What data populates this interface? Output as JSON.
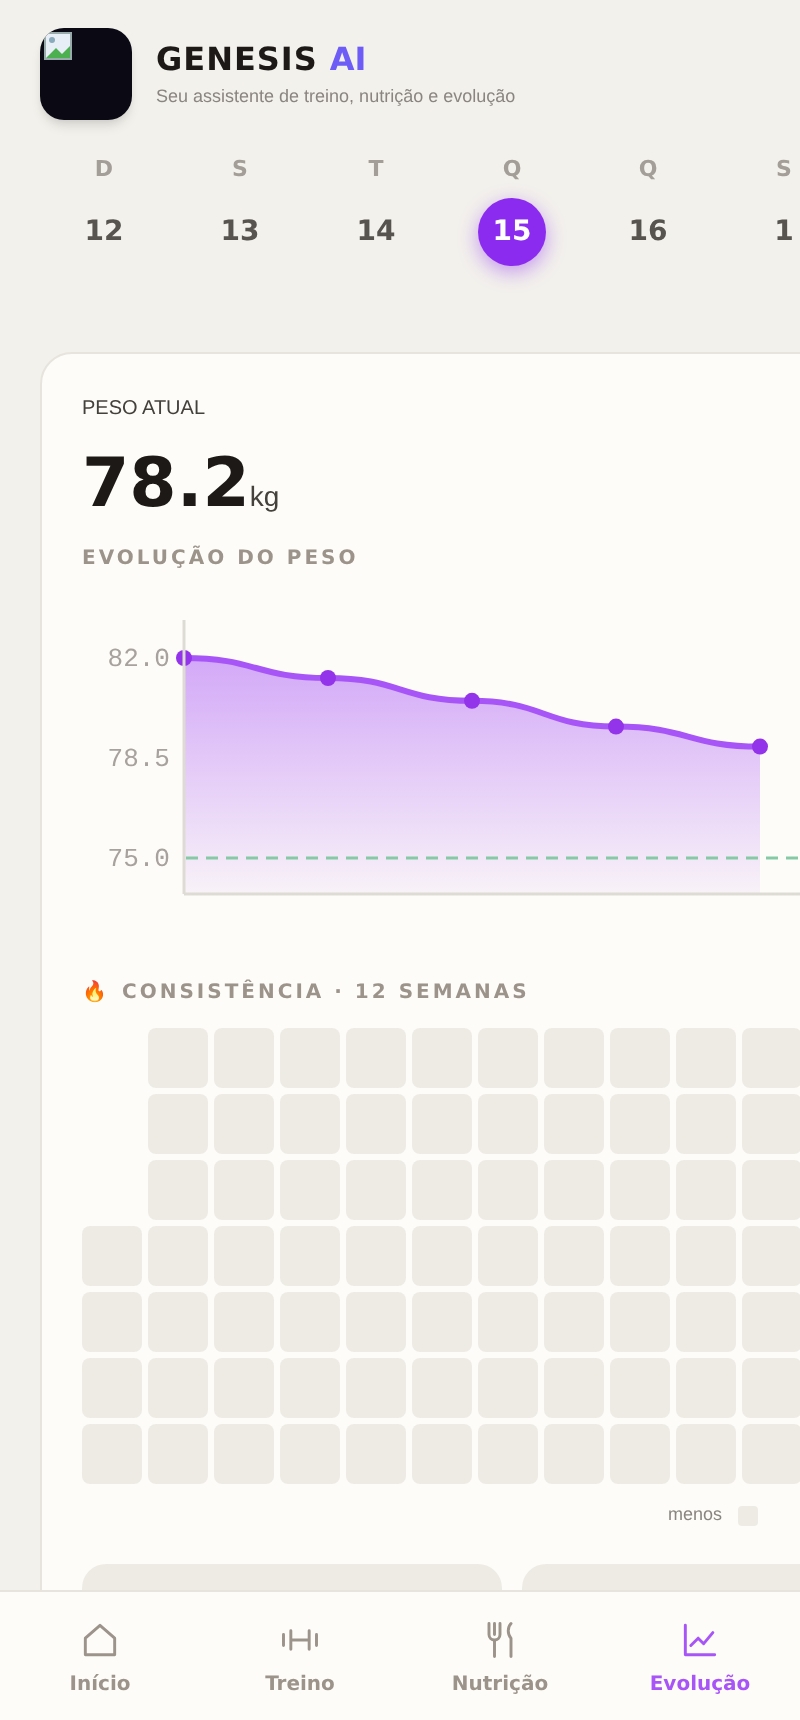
{
  "header": {
    "title": "GENESIS",
    "title_accent": "AI",
    "subtitle": "Seu assistente de treino, nutrição e evolução"
  },
  "days": [
    {
      "weekday": "D",
      "date": "12",
      "selected": false
    },
    {
      "weekday": "S",
      "date": "13",
      "selected": false
    },
    {
      "weekday": "T",
      "date": "14",
      "selected": false
    },
    {
      "weekday": "Q",
      "date": "15",
      "selected": true
    },
    {
      "weekday": "Q",
      "date": "16",
      "selected": false
    },
    {
      "weekday": "S",
      "date": "1",
      "selected": false
    }
  ],
  "weight": {
    "label": "PESO ATUAL",
    "value": "78.2",
    "unit": "kg",
    "chart_title": "EVOLUÇÃO DO PESO",
    "chart_data": {
      "type": "area",
      "values": [
        82.0,
        81.3,
        80.5,
        79.6,
        78.9
      ],
      "ylim": [
        73.74,
        83.33
      ],
      "yticks": [
        {
          "value": 82,
          "label": "82.0"
        },
        {
          "value": 78.5,
          "label": "78.5"
        },
        {
          "value": 75,
          "label": "75.0"
        }
      ]
    }
  },
  "consistency": {
    "icon": "🔥",
    "title": "CONSISTÊNCIA · 12 SEMANAS",
    "legend_low": "menos"
  },
  "nav": [
    {
      "kind": "home",
      "label": "Início",
      "selected": false
    },
    {
      "kind": "workout",
      "label": "Treino",
      "selected": false
    },
    {
      "kind": "food",
      "label": "Nutrição",
      "selected": false
    },
    {
      "kind": "chart",
      "label": "Evolução",
      "selected": true
    }
  ]
}
